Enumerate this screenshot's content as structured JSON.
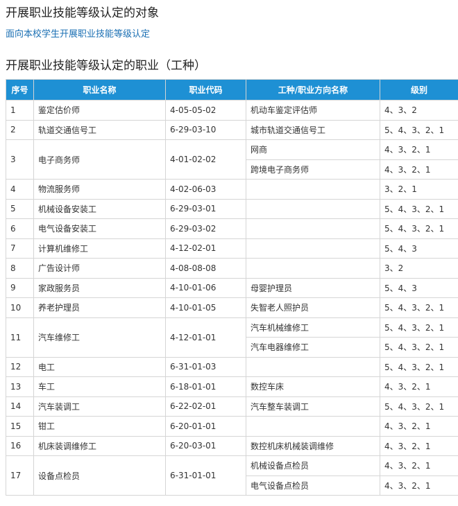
{
  "heading_target": "开展职业技能等级认定的对象",
  "target_link": "面向本校学生开展职业技能等级认定",
  "heading_occupation": "开展职业技能等级认定的职业（工种）",
  "table": {
    "headers": [
      "序号",
      "职业名称",
      "职业代码",
      "工种/职业方向名称",
      "级别"
    ],
    "rows": [
      {
        "no": "1",
        "name": "鉴定估价师",
        "code": "4-05-05-02",
        "subs": [
          {
            "t": "机动车鉴定评估师",
            "l": "4、3、2"
          }
        ]
      },
      {
        "no": "2",
        "name": "轨道交通信号工",
        "code": "6-29-03-10",
        "subs": [
          {
            "t": "城市轨道交通信号工",
            "l": "5、4、3、2、1"
          }
        ]
      },
      {
        "no": "3",
        "name": "电子商务师",
        "code": "4-01-02-02",
        "subs": [
          {
            "t": "网商",
            "l": "4、3、2、1"
          },
          {
            "t": "跨境电子商务师",
            "l": "4、3、2、1"
          }
        ]
      },
      {
        "no": "4",
        "name": "物流服务师",
        "code": "4-02-06-03",
        "subs": [
          {
            "t": "",
            "l": "3、2、1"
          }
        ]
      },
      {
        "no": "5",
        "name": "机械设备安装工",
        "code": "6-29-03-01",
        "subs": [
          {
            "t": "",
            "l": "5、4、3、2、1"
          }
        ]
      },
      {
        "no": "6",
        "name": "电气设备安装工",
        "code": "6-29-03-02",
        "subs": [
          {
            "t": "",
            "l": "5、4、3、2、1"
          }
        ]
      },
      {
        "no": "7",
        "name": "计算机维修工",
        "code": "4-12-02-01",
        "subs": [
          {
            "t": "",
            "l": "5、4、3"
          }
        ]
      },
      {
        "no": "8",
        "name": "广告设计师",
        "code": "4-08-08-08",
        "subs": [
          {
            "t": "",
            "l": "3、2"
          }
        ]
      },
      {
        "no": "9",
        "name": "家政服务员",
        "code": "4-10-01-06",
        "subs": [
          {
            "t": "母婴护理员",
            "l": "5、4、3"
          }
        ]
      },
      {
        "no": "10",
        "name": "养老护理员",
        "code": "4-10-01-05",
        "subs": [
          {
            "t": "失智老人照护员",
            "l": "5、4、3、2、1"
          }
        ]
      },
      {
        "no": "11",
        "name": "汽车维修工",
        "code": "4-12-01-01",
        "subs": [
          {
            "t": "汽车机械维修工",
            "l": "5、4、3、2、1"
          },
          {
            "t": "汽车电器维修工",
            "l": "5、4、3、2、1"
          }
        ]
      },
      {
        "no": "12",
        "name": "电工",
        "code": "6-31-01-03",
        "subs": [
          {
            "t": "",
            "l": "5、4、3、2、1"
          }
        ]
      },
      {
        "no": "13",
        "name": "车工",
        "code": "6-18-01-01",
        "subs": [
          {
            "t": "数控车床",
            "l": "4、3、2、1"
          }
        ]
      },
      {
        "no": "14",
        "name": "汽车装调工",
        "code": "6-22-02-01",
        "subs": [
          {
            "t": "汽车整车装调工",
            "l": "5、4、3、2、1"
          }
        ]
      },
      {
        "no": "15",
        "name": "钳工",
        "code": "6-20-01-01",
        "subs": [
          {
            "t": "",
            "l": "4、3、2、1"
          }
        ]
      },
      {
        "no": "16",
        "name": "机床装调维修工",
        "code": "6-20-03-01",
        "subs": [
          {
            "t": "数控机床机械装调维修",
            "l": "4、3、2、1"
          }
        ]
      },
      {
        "no": "17",
        "name": "设备点检员",
        "code": "6-31-01-01",
        "subs": [
          {
            "t": "机械设备点检员",
            "l": "4、3、2、1"
          },
          {
            "t": "电气设备点检员",
            "l": "4、3、2、1"
          }
        ]
      }
    ]
  }
}
